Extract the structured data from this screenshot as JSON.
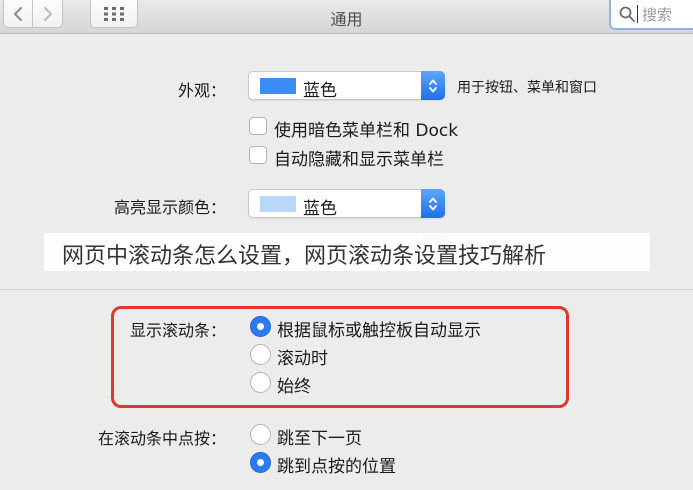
{
  "window": {
    "title": "通用",
    "search_placeholder": "搜索"
  },
  "appearance": {
    "label": "外观：",
    "selected": "蓝色",
    "swatch_color": "#3a8cf6",
    "hint": "用于按钮、菜单和窗口",
    "dark_menu_label": "使用暗色菜单栏和 Dock",
    "autohide_menu_label": "自动隐藏和显示菜单栏"
  },
  "highlight": {
    "label": "高亮显示颜色：",
    "selected": "蓝色",
    "swatch_color": "#b8d7fb"
  },
  "overlay": {
    "caption": "网页中滚动条怎么设置，网页滚动条设置技巧解析"
  },
  "show_scrollbars": {
    "label": "显示滚动条：",
    "options": [
      "根据鼠标或触控板自动显示",
      "滚动时",
      "始终"
    ],
    "selected_index": 0
  },
  "click_scrollbar": {
    "label": "在滚动条中点按：",
    "options": [
      "跳至下一页",
      "跳到点按的位置"
    ],
    "selected_index": 1
  }
}
